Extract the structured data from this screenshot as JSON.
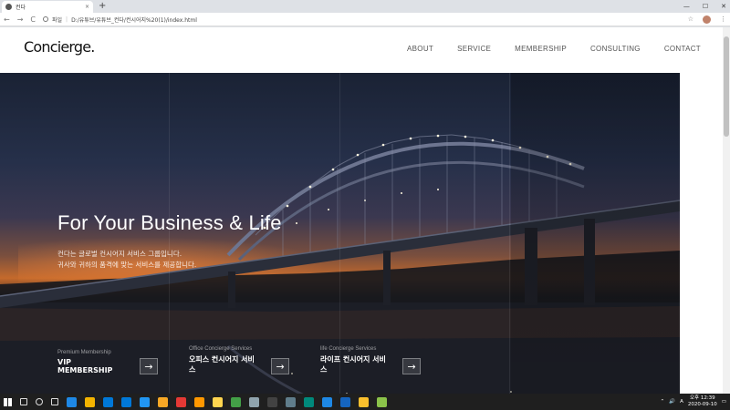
{
  "browser": {
    "tab_title": "컨다",
    "tab_close": "×",
    "new_tab": "+",
    "window_controls": [
      "—",
      "☐",
      "✕"
    ],
    "address_scheme": "파일",
    "address_url": "D:/유튜브/유튜브_컨다/컨시어지%20(1)/index.html",
    "nav_back": "←",
    "nav_forward": "→",
    "nav_reload": "C",
    "star": "☆",
    "menu": "⋮"
  },
  "site": {
    "logo": "Concierge.",
    "nav": [
      "ABOUT",
      "SERVICE",
      "MEMBERSHIP",
      "CONSULTING",
      "CONTACT"
    ]
  },
  "hero": {
    "title": "For Your Business & Life",
    "desc_line1": "컨다는 글로벌 컨시어지 서비스 그룹입니다.",
    "desc_line2": "귀사와 귀하의 품격에 맞는 서비스를 제공합니다.",
    "services": [
      {
        "sub": "Premium Membership",
        "main": "VIP MEMBERSHIP",
        "arrow": "→"
      },
      {
        "sub": "Office Concierge Services",
        "main": "오피스 컨시어지 서비스",
        "arrow": "→"
      },
      {
        "sub": "life Concierge Services",
        "main": "라이프 컨시어지 서비스",
        "arrow": "→"
      }
    ]
  },
  "taskbar": {
    "time": "오후 12:39",
    "date": "2020-09-10",
    "ime": "A",
    "colors": [
      "#1e88e5",
      "#f4b400",
      "#0078d7",
      "#0078d7",
      "#2196f3",
      "#f9a825",
      "#e53935",
      "#ff9800",
      "#ffd54f",
      "#43a047",
      "#90a4ae",
      "#424242",
      "#607d8b",
      "#00897b",
      "#1e88e5",
      "#1565c0",
      "#fbc02d",
      "#8bc34a"
    ]
  }
}
